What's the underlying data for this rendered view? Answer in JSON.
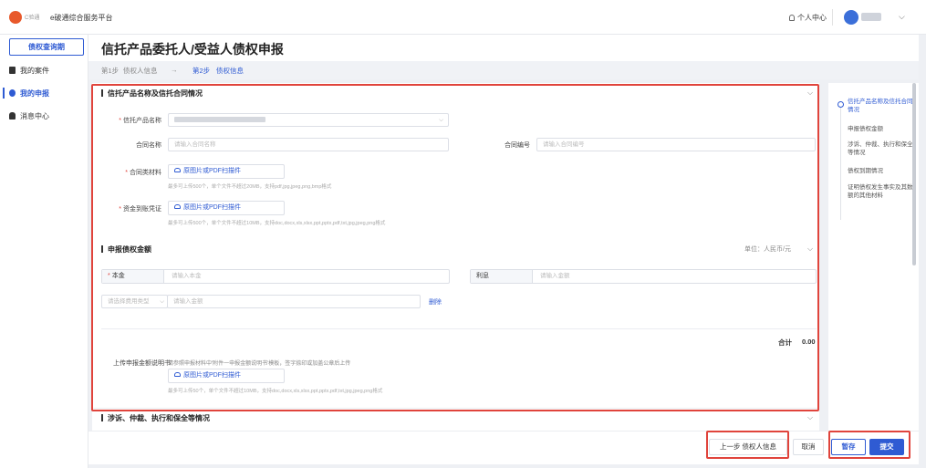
{
  "header": {
    "logo_text": "C验通",
    "platform_name": "e破通综合服务平台",
    "user_center": "个人中心"
  },
  "sidebar": {
    "primary_button": "债权查询期",
    "items": [
      {
        "label": "我的案件",
        "active": false
      },
      {
        "label": "我的申报",
        "active": true
      },
      {
        "label": "消息中心",
        "active": false
      }
    ]
  },
  "page": {
    "title": "信托产品委托人/受益人债权申报",
    "steps": {
      "step1": "第1步",
      "step1_label": "债权人信息",
      "arrow": "→",
      "step2": "第2步",
      "step2_label": "债权信息"
    }
  },
  "section1": {
    "title": "信托产品名称及信托合同情况",
    "product_name_label": "信托产品名称",
    "contract_name_label": "合同名称",
    "contract_name_placeholder": "请输入合同名称",
    "contract_no_label": "合同编号",
    "contract_no_placeholder": "请输入合同编号",
    "contract_material_label": "合同类材料",
    "funds_proof_label": "资金到账凭证",
    "upload_label": "原图片或PDF扫描件",
    "hint_contract": "最多可上传500个，单个文件不超过20MB，支持pdf,jpg,jpeg,png,bmp格式",
    "hint_funds": "最多可上传500个，单个文件不超过10MB，支持doc,docx,xls,xlsx,ppt,pptx,pdf,txt,jpg,jpeg,png格式"
  },
  "section2": {
    "title": "申报债权金额",
    "unit": "单位：人民币/元",
    "principal_label": "本金",
    "principal_placeholder": "请输入本金",
    "interest_label": "利息",
    "interest_placeholder": "请输入金额",
    "fee_type_placeholder": "请选择费用类型",
    "fee_amount_placeholder": "请输入金额",
    "delete_label": "删除",
    "total_label": "合计",
    "total_value": "0.00",
    "upload_statement_label": "上传申报金额说明书",
    "upload_statement_desc": "请参照申报材料中'附件一申报金额说明书'模板，签字捺印或加盖公章后上传",
    "upload_label": "原图片或PDF扫描件",
    "hint_statement": "最多可上传50个，单个文件不超过10MB，支持doc,docx,xls,xlsx,ppt,pptx,pdf,txt,jpg,jpeg,png格式"
  },
  "section3": {
    "title": "涉诉、仲裁、执行和保全等情况"
  },
  "anchor_nav": {
    "items": [
      {
        "label": "信托产品名称及信托合同情况",
        "active": true
      },
      {
        "label": "申报债权金额",
        "active": false
      },
      {
        "label": "涉诉、仲裁、执行和保全等情况",
        "active": false
      },
      {
        "label": "债权到期情况",
        "active": false
      },
      {
        "label": "证明债权发生事实及其数额的其他材料",
        "active": false
      }
    ]
  },
  "footer": {
    "prev_button": "上一步 债权人信息",
    "cancel_button": "取消",
    "save_button": "暂存",
    "submit_button": "提交"
  },
  "colors": {
    "primary": "#2f5bd3",
    "highlight": "#e0443c"
  }
}
